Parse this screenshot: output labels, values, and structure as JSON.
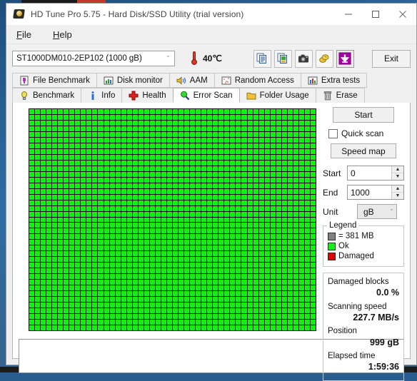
{
  "window": {
    "title": "HD Tune Pro 5.75 - Hard Disk/SSD Utility (trial version)",
    "app_icon": "hard-disk-icon",
    "minimize": "—",
    "maximize": "☐",
    "close": "✕"
  },
  "menu": {
    "items": [
      {
        "label": "File",
        "mnemonic": "F",
        "rest": "ile"
      },
      {
        "label": "Help",
        "mnemonic": "H",
        "rest": "elp"
      }
    ]
  },
  "toolbar": {
    "drive": "ST1000DM010-2EP102 (1000 gB)",
    "drive_chevron": "ˇ",
    "temperature": "40℃",
    "buttons": [
      {
        "name": "copy-text-icon",
        "title": "copy text"
      },
      {
        "name": "copy-image-icon",
        "title": "copy image"
      },
      {
        "name": "screenshot-camera-icon",
        "title": "screenshot"
      },
      {
        "name": "coins-icon",
        "title": "coins"
      },
      {
        "name": "download-arrow-icon",
        "title": "download"
      }
    ],
    "exit_label": "Exit"
  },
  "tabs": {
    "row1": [
      {
        "label": "File Benchmark",
        "icon": "file-benchmark-icon",
        "active": false
      },
      {
        "label": "Disk monitor",
        "icon": "disk-monitor-icon",
        "active": false
      },
      {
        "label": "AAM",
        "icon": "speaker-icon",
        "active": false
      },
      {
        "label": "Random Access",
        "icon": "random-access-icon",
        "active": false
      },
      {
        "label": "Extra tests",
        "icon": "extra-tests-icon",
        "active": false
      }
    ],
    "row2": [
      {
        "label": "Benchmark",
        "icon": "bulb-icon",
        "active": false
      },
      {
        "label": "Info",
        "icon": "info-icon",
        "active": false
      },
      {
        "label": "Health",
        "icon": "health-cross-icon",
        "active": false
      },
      {
        "label": "Error Scan",
        "icon": "magnifier-icon",
        "active": true
      },
      {
        "label": "Folder Usage",
        "icon": "folder-icon",
        "active": false
      },
      {
        "label": "Erase",
        "icon": "trash-icon",
        "active": false
      }
    ]
  },
  "controls": {
    "start_label": "Start",
    "quick_scan_label": "Quick scan",
    "quick_scan_checked": false,
    "speed_map_label": "Speed map",
    "start_field_label": "Start",
    "start_field_value": "0",
    "end_field_label": "End",
    "end_field_value": "1000",
    "unit_label": "Unit",
    "unit_value": "gB",
    "unit_chevron": "ˇ",
    "spin_up": "▲",
    "spin_down": "▼"
  },
  "legend": {
    "title": "Legend",
    "block_size": "= 381 MB",
    "ok_label": "Ok",
    "damaged_label": "Damaged",
    "colors": {
      "ok": "#13f013",
      "damaged": "#e00000",
      "block": "#808080"
    }
  },
  "stats": [
    {
      "key": "Damaged blocks",
      "value": "0.0 %"
    },
    {
      "key": "Scanning speed",
      "value": "227.7 MB/s"
    },
    {
      "key": "Position",
      "value": "999 gB"
    },
    {
      "key": "Elapsed time",
      "value": "1:59:36"
    }
  ],
  "scan_grid": {
    "columns": 50,
    "rows": 39,
    "total_blocks": 1950,
    "damaged_blocks": 0,
    "ok_color": "#13f013",
    "grid_line_color": "#000000"
  }
}
